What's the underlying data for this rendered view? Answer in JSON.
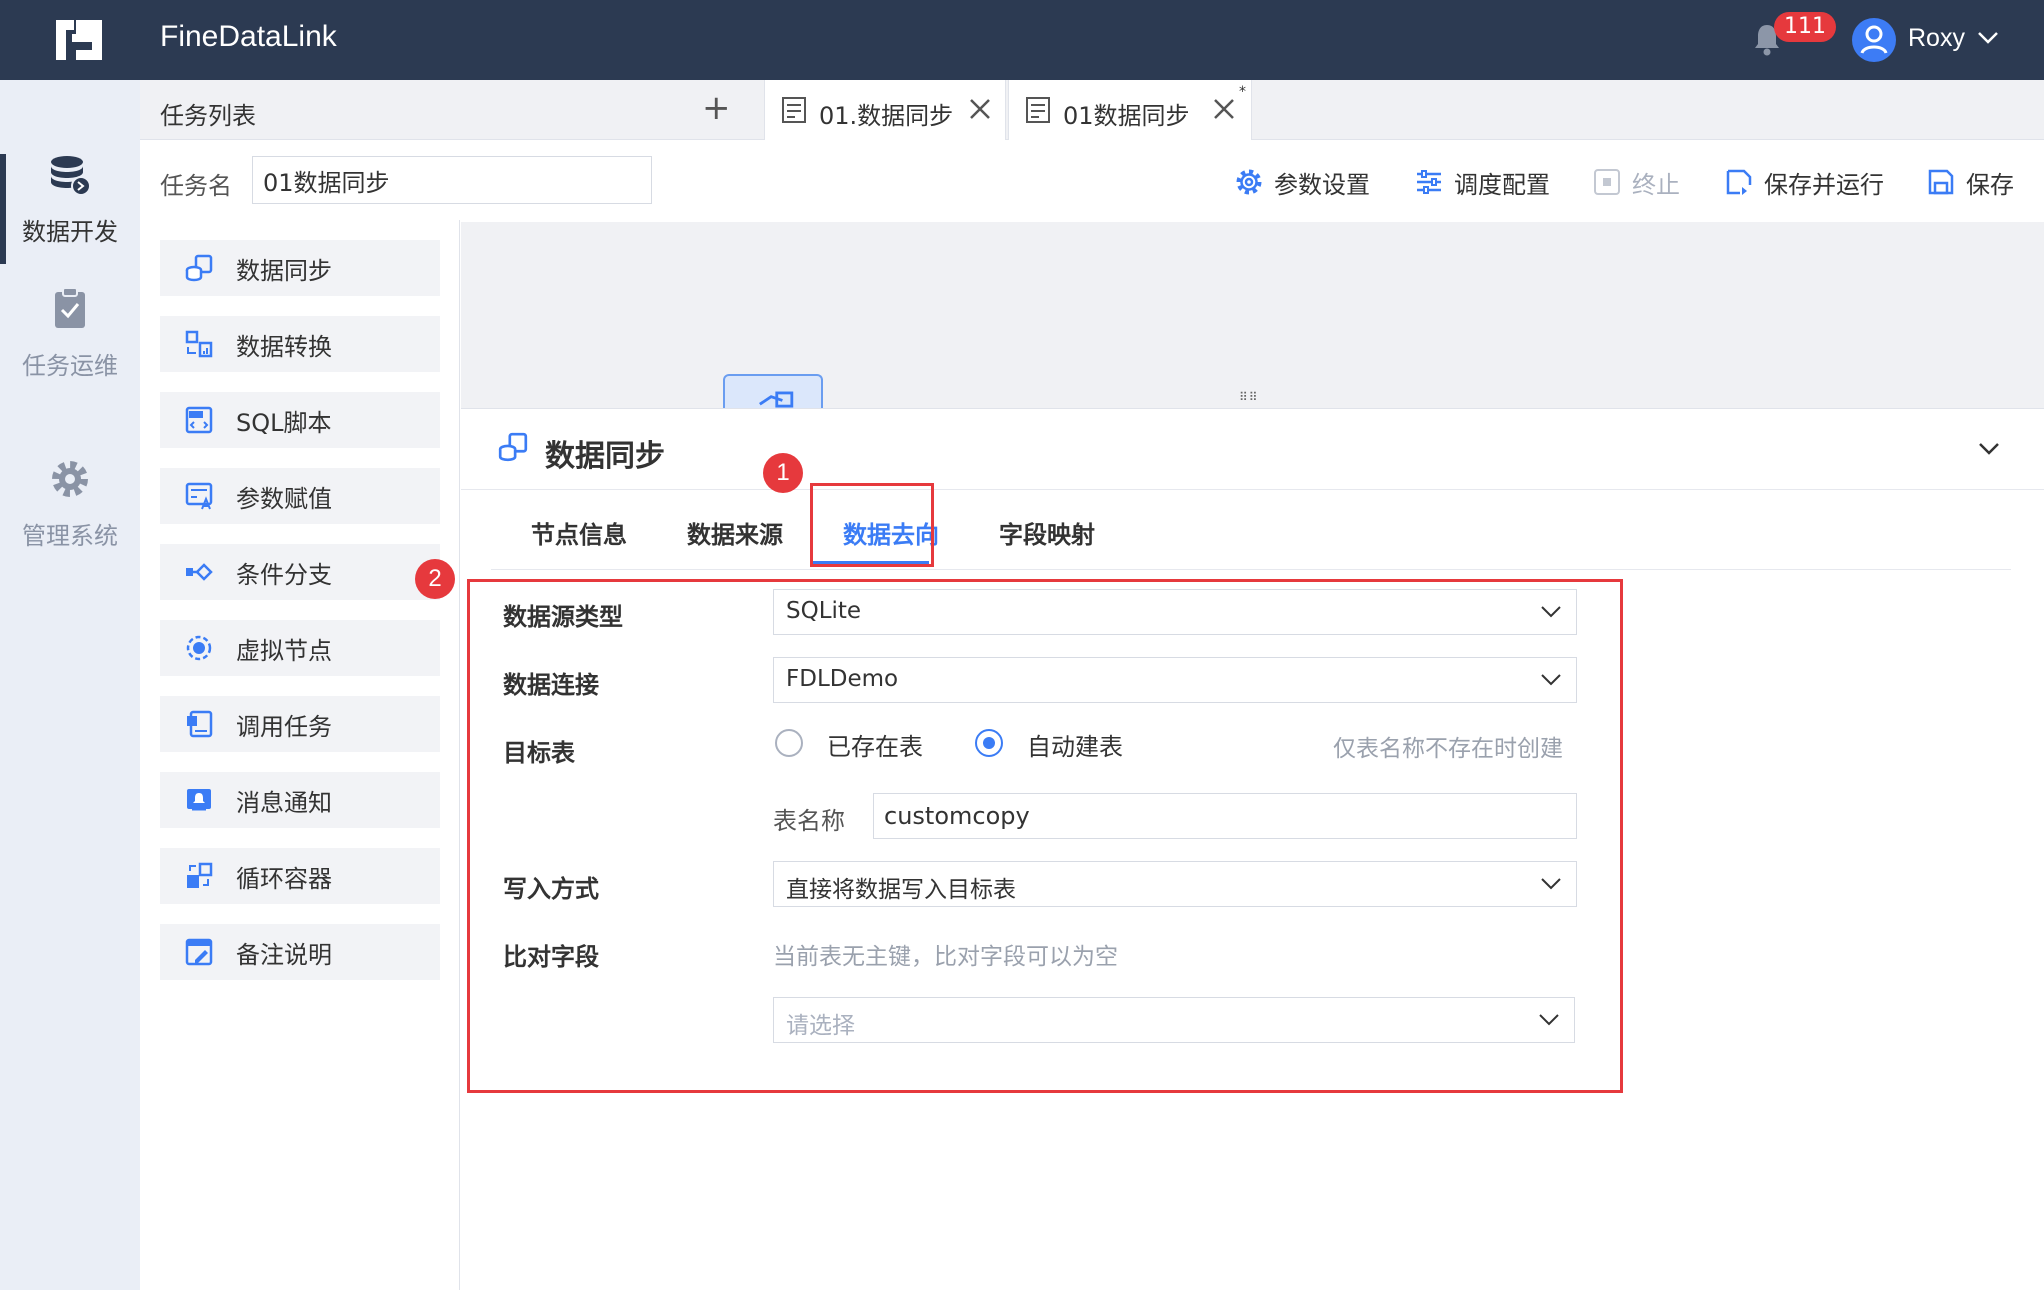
{
  "app": {
    "title": "FineDataLink"
  },
  "header": {
    "notification_count": "111",
    "username": "Roxy"
  },
  "leftnav": {
    "items": [
      {
        "label": "数据开发",
        "icon": "database-icon",
        "active": true
      },
      {
        "label": "任务运维",
        "icon": "clipboard-check-icon",
        "active": false
      },
      {
        "label": "管理系统",
        "icon": "gear-icon",
        "active": false
      }
    ]
  },
  "tabs": {
    "list_title": "任务列表",
    "add_label": "+",
    "open": [
      {
        "label": "01.数据同步",
        "modified": false
      },
      {
        "label": "01数据同步",
        "modified": true,
        "modified_mark": "*"
      }
    ]
  },
  "task": {
    "name_label": "任务名",
    "name_value": "01数据同步"
  },
  "toolbar": {
    "params_label": "参数设置",
    "schedule_label": "调度配置",
    "stop_label": "终止",
    "save_run_label": "保存并运行",
    "save_label": "保存"
  },
  "nodes": [
    {
      "label": "数据同步",
      "icon": "data-sync-icon"
    },
    {
      "label": "数据转换",
      "icon": "data-transform-icon"
    },
    {
      "label": "SQL脚本",
      "icon": "sql-script-icon"
    },
    {
      "label": "参数赋值",
      "icon": "param-assign-icon"
    },
    {
      "label": "条件分支",
      "icon": "condition-branch-icon"
    },
    {
      "label": "虚拟节点",
      "icon": "virtual-node-icon"
    },
    {
      "label": "调用任务",
      "icon": "invoke-task-icon"
    },
    {
      "label": "消息通知",
      "icon": "notification-icon"
    },
    {
      "label": "循环容器",
      "icon": "loop-container-icon"
    },
    {
      "label": "备注说明",
      "icon": "note-icon"
    }
  ],
  "panel": {
    "title": "数据同步",
    "tabs": [
      "节点信息",
      "数据来源",
      "数据去向",
      "字段映射"
    ],
    "active_tab": "数据去向",
    "callouts": [
      "1",
      "2"
    ],
    "form": {
      "source_type_label": "数据源类型",
      "source_type_value": "SQLite",
      "connection_label": "数据连接",
      "connection_value": "FDLDemo",
      "target_table_label": "目标表",
      "option_existing": "已存在表",
      "option_auto": "自动建表",
      "selected_option": "自动建表",
      "auto_hint": "仅表名称不存在时创建",
      "table_name_label": "表名称",
      "table_name_value": "customcopy",
      "write_mode_label": "写入方式",
      "write_mode_value": "直接将数据写入目标表",
      "compare_label": "比对字段",
      "compare_hint": "当前表无主键，比对字段可以为空",
      "compare_placeholder": "请选择"
    }
  },
  "colors": {
    "topbar": "#2c3a52",
    "accent": "#3b7cf5",
    "callout": "#e6393d"
  }
}
